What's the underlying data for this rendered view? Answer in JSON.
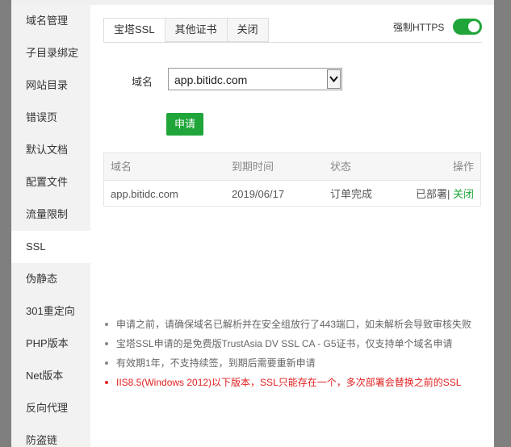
{
  "sidebar": {
    "items": [
      {
        "label": "域名管理"
      },
      {
        "label": "子目录绑定"
      },
      {
        "label": "网站目录"
      },
      {
        "label": "错误页"
      },
      {
        "label": "默认文档"
      },
      {
        "label": "配置文件"
      },
      {
        "label": "流量限制"
      },
      {
        "label": "SSL"
      },
      {
        "label": "伪静态"
      },
      {
        "label": "301重定向"
      },
      {
        "label": "PHP版本"
      },
      {
        "label": "Net版本"
      },
      {
        "label": "反向代理"
      },
      {
        "label": "防盗链"
      }
    ],
    "active": "SSL"
  },
  "tabs": [
    {
      "label": "宝塔SSL",
      "active": true
    },
    {
      "label": "其他证书",
      "active": false
    },
    {
      "label": "关闭",
      "active": false
    }
  ],
  "force_https": {
    "label": "强制HTTPS",
    "on": true
  },
  "form": {
    "domain_label": "域名",
    "domain_value": "app.bitidc.com",
    "apply_label": "申请"
  },
  "table": {
    "headers": {
      "domain": "域名",
      "expire": "到期时间",
      "status": "状态",
      "action": "操作"
    },
    "rows": [
      {
        "domain": "app.bitidc.com",
        "expire": "2019/06/17",
        "status": "订单完成",
        "deployed": "已部署|",
        "close": "关闭"
      }
    ]
  },
  "notes": [
    {
      "text": "申请之前，请确保域名已解析并在安全组放行了443端口，如未解析会导致审核失败",
      "warning": false
    },
    {
      "text": "宝塔SSL申请的是免费版TrustAsia DV SSL CA - G5证书，仅支持单个域名申请",
      "warning": false
    },
    {
      "text": "有效期1年，不支持续签，到期后需要重新申请",
      "warning": false
    },
    {
      "text": "IIS8.5(Windows 2012)以下版本，SSL只能存在一个，多次部署会替换之前的SSL",
      "warning": true
    }
  ],
  "colors": {
    "accent": "#20a53a",
    "warning": "#e02020",
    "overlay": "#7f7f7f",
    "sidebar_bg": "#f2f2f2"
  }
}
